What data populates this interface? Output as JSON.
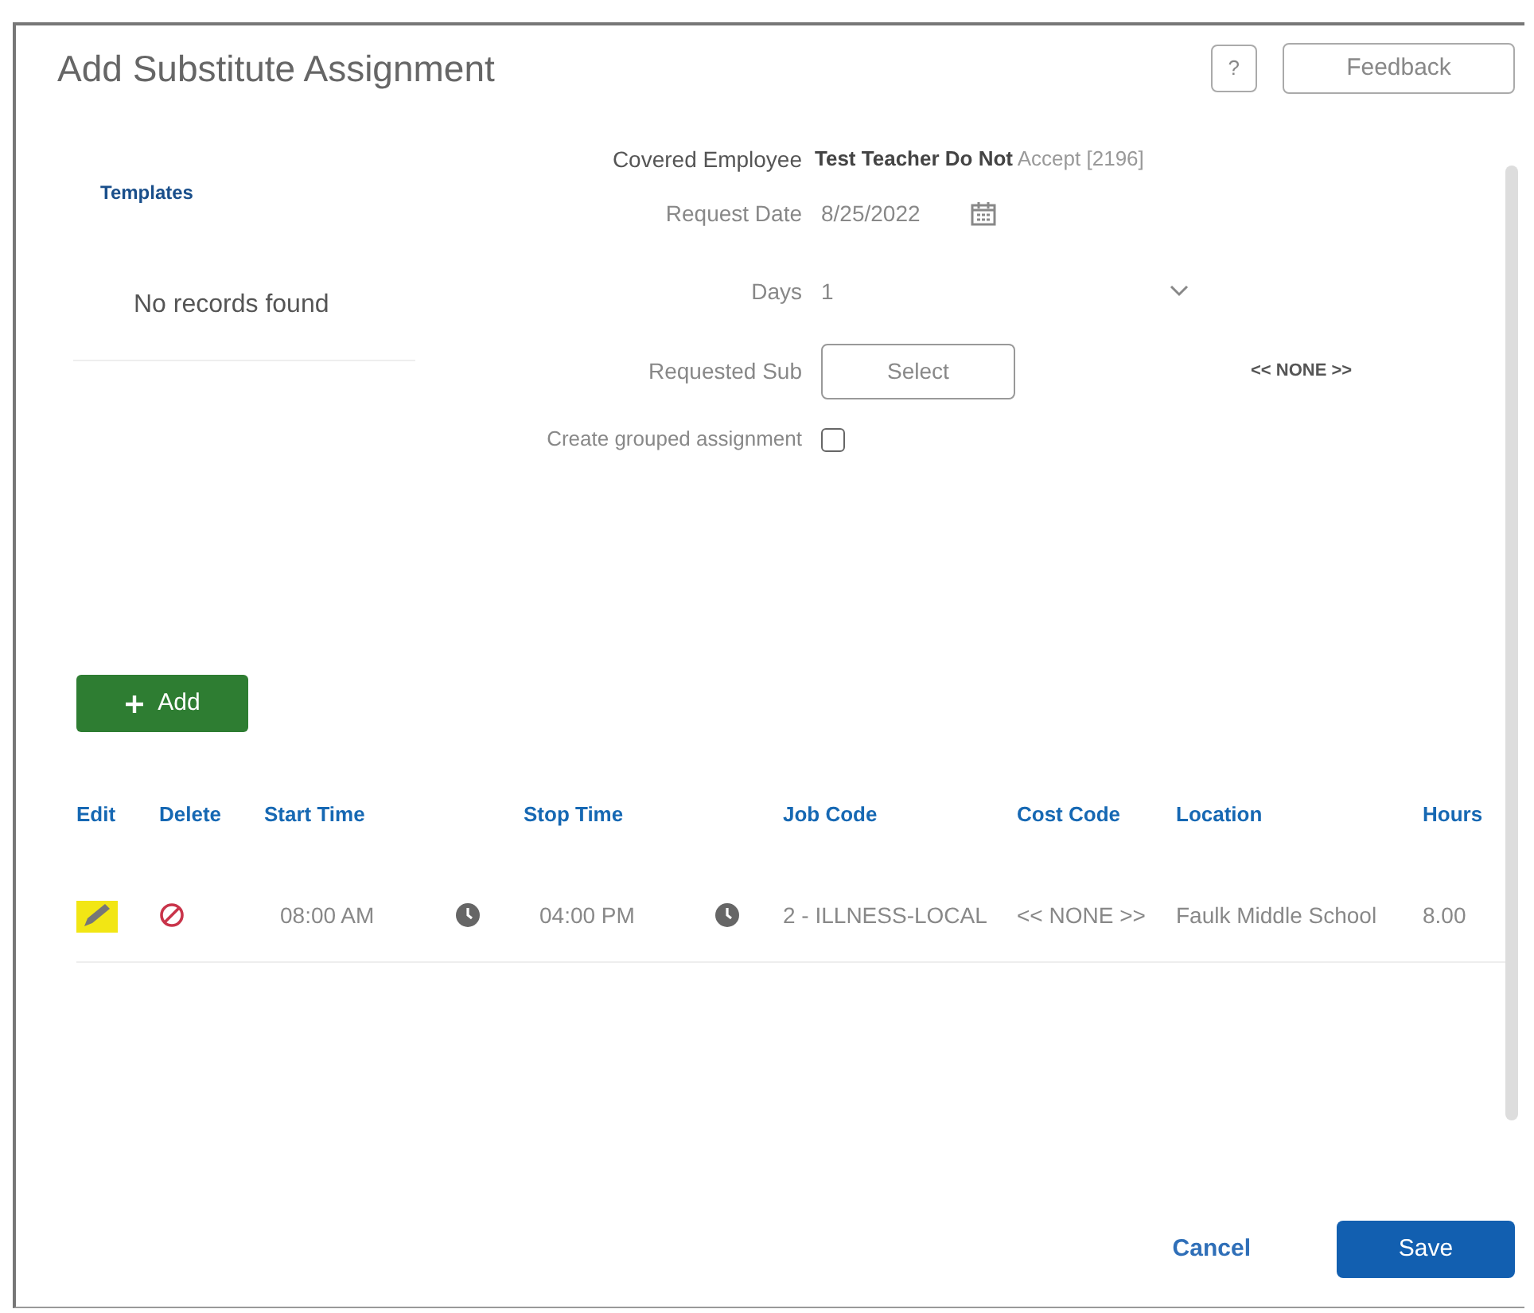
{
  "dialog": {
    "title": "Add Substitute Assignment",
    "help_button": "?",
    "feedback_button": "Feedback"
  },
  "templates": {
    "title": "Templates",
    "empty_text": "No records found"
  },
  "form": {
    "covered_employee": {
      "label": "Covered Employee",
      "value": "Test Teacher Do Not",
      "value_suffix": "Accept [2196]"
    },
    "request_date": {
      "label": "Request Date",
      "value": "8/25/2022"
    },
    "days": {
      "label": "Days",
      "value": "1"
    },
    "requested_sub": {
      "label": "Requested Sub",
      "button": "Select",
      "value": "<< NONE >>"
    },
    "grouped": {
      "label": "Create grouped assignment",
      "checked": false
    }
  },
  "add_button": "Add",
  "table": {
    "columns": [
      "Edit",
      "Delete",
      "Start Time",
      "Stop Time",
      "Job Code",
      "Cost Code",
      "Location",
      "Hours"
    ],
    "rows": [
      {
        "start_time": "08:00 AM",
        "stop_time": "04:00 PM",
        "job_code": "2 - ILLNESS-LOCAL",
        "cost_code": "<< NONE >>",
        "location": "Faulk Middle School",
        "hours": "8.00"
      }
    ]
  },
  "footer": {
    "cancel": "Cancel",
    "save": "Save"
  }
}
